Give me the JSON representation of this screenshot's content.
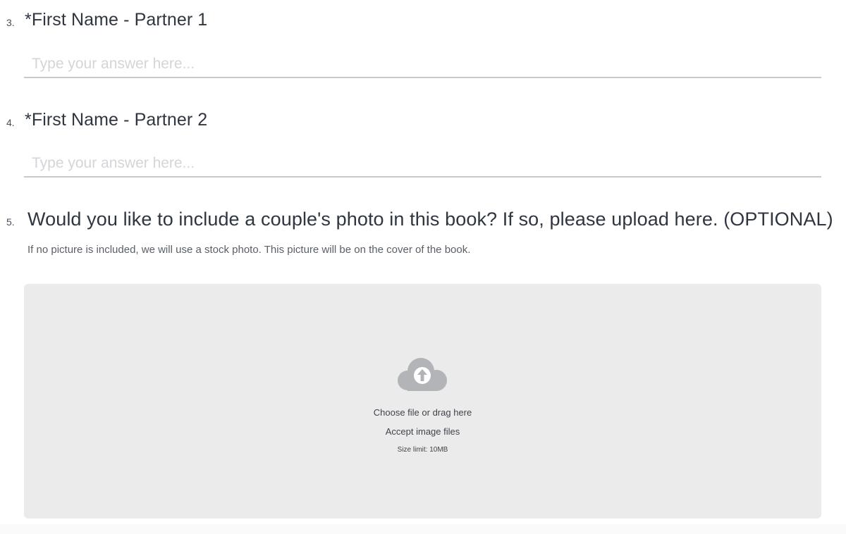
{
  "questions": [
    {
      "number": "3.",
      "title": "*First Name - Partner 1",
      "placeholder": "Type your answer here..."
    },
    {
      "number": "4.",
      "title": "*First Name - Partner 2",
      "placeholder": "Type your answer here..."
    },
    {
      "number": "5.",
      "title": "Would you like to include a couple's photo in this book? If so, please upload here. (OPTIONAL)",
      "description": "If no picture is included, we will use a stock photo. This picture will be on the cover of the book."
    }
  ],
  "upload": {
    "icon": "cloud-upload-icon",
    "prompt": "Choose file or drag here",
    "accept": "Accept image files",
    "size_limit": "Size limit: 10MB"
  },
  "colors": {
    "dropzone_bg": "#ebebec",
    "icon_gray": "#b3b4b7",
    "input_underline": "#c7c9cc",
    "placeholder": "#d3d5d8"
  }
}
